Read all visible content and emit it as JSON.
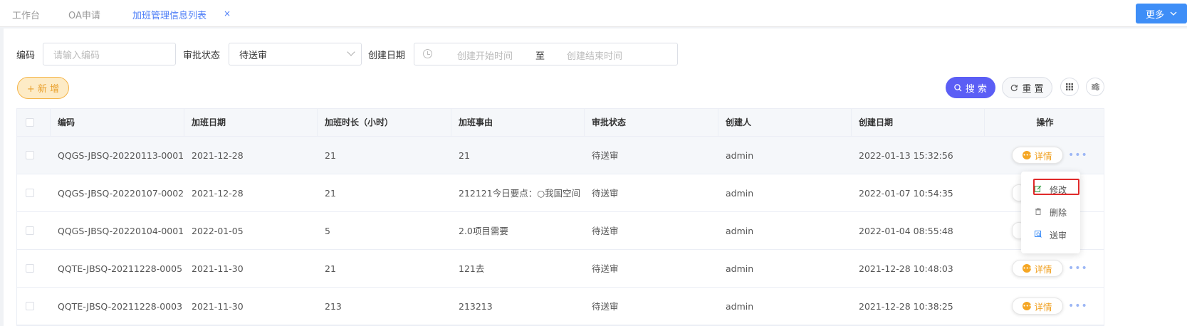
{
  "tabs": [
    {
      "label": "工作台",
      "active": false
    },
    {
      "label": "OA申请",
      "active": false
    },
    {
      "label": "加班管理信息列表",
      "active": true
    }
  ],
  "tab_close": "×",
  "more_button": "更多",
  "filters": {
    "code_label": "编码",
    "code_placeholder": "请输入编码",
    "status_label": "审批状态",
    "status_value": "待送审",
    "date_label": "创建日期",
    "date_start_placeholder": "创建开始时间",
    "date_separator": "至",
    "date_end_placeholder": "创建结束时间"
  },
  "toolbar": {
    "add": "+ 新 增",
    "search": "搜 索",
    "reset": "重 置"
  },
  "table": {
    "headers": [
      "编码",
      "加班日期",
      "加班时长（小时）",
      "加班事由",
      "审批状态",
      "创建人",
      "创建日期",
      "操作"
    ],
    "rows": [
      {
        "code": "QQGS-JBSQ-20220113-0001",
        "date": "2021-12-28",
        "hours": "21",
        "reason": "21",
        "status": "待送审",
        "creator": "admin",
        "created": "2022-01-13 15:32:56"
      },
      {
        "code": "QQGS-JBSQ-20220107-0002",
        "date": "2021-12-28",
        "hours": "21",
        "reason": "212121今日要点：○我国空间...",
        "status": "待送审",
        "creator": "admin",
        "created": "2022-01-07 10:54:35"
      },
      {
        "code": "QQGS-JBSQ-20220104-0001",
        "date": "2022-01-05",
        "hours": "5",
        "reason": "2.0项目需要",
        "status": "待送审",
        "creator": "admin",
        "created": "2022-01-04 08:55:48"
      },
      {
        "code": "QQTE-JBSQ-20211228-0005",
        "date": "2021-11-30",
        "hours": "21",
        "reason": "121去",
        "status": "待送审",
        "creator": "admin",
        "created": "2021-12-28 10:48:03"
      },
      {
        "code": "QQTE-JBSQ-20211228-0003",
        "date": "2021-11-30",
        "hours": "213",
        "reason": "213213",
        "status": "待送审",
        "creator": "admin",
        "created": "2021-12-28 10:38:25"
      }
    ],
    "detail_label": "详情",
    "more_ellipsis": "•••"
  },
  "action_menu": {
    "edit": "修改",
    "delete": "删除",
    "submit": "送审"
  },
  "colors": {
    "primary": "#5b5ef5",
    "tab_active": "#4d7ef7",
    "warning": "#f5a623",
    "highlight": "#e02a2a"
  }
}
